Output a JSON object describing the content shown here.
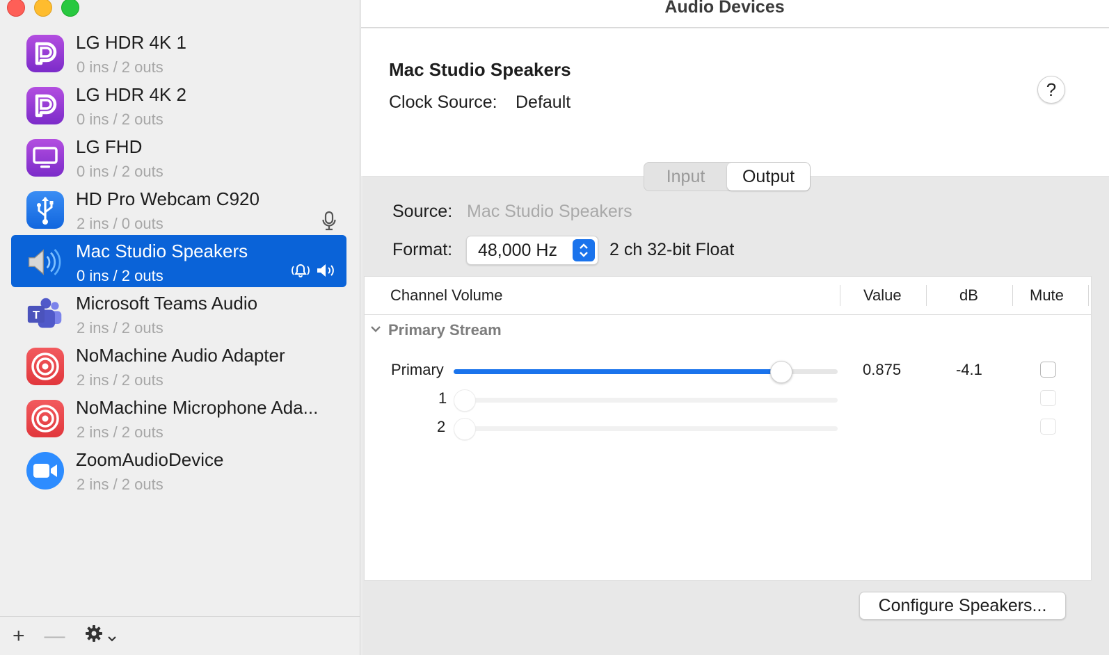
{
  "window": {
    "title": "Audio Devices"
  },
  "devices": [
    {
      "name": "LG HDR 4K 1",
      "io": "0 ins / 2 outs",
      "icon": "displayport-icon"
    },
    {
      "name": "LG HDR 4K 2",
      "io": "0 ins / 2 outs",
      "icon": "displayport-icon"
    },
    {
      "name": "LG FHD",
      "io": "0 ins / 2 outs",
      "icon": "monitor-icon"
    },
    {
      "name": "HD Pro Webcam C920",
      "io": "2 ins / 0 outs",
      "icon": "usb-icon",
      "badge": "microphone-icon"
    },
    {
      "name": "Mac Studio Speakers",
      "io": "0 ins / 2 outs",
      "icon": "speaker-icon",
      "selected": true
    },
    {
      "name": "Microsoft Teams Audio",
      "io": "2 ins / 2 outs",
      "icon": "teams-icon"
    },
    {
      "name": "NoMachine Audio Adapter",
      "io": "2 ins / 2 outs",
      "icon": "nomachine-icon"
    },
    {
      "name": "NoMachine Microphone Ada...",
      "io": "2 ins / 2 outs",
      "icon": "nomachine-icon"
    },
    {
      "name": "ZoomAudioDevice",
      "io": "2 ins / 2 outs",
      "icon": "zoom-icon"
    }
  ],
  "sidebar_toolbar": {
    "add": "+",
    "remove": "—"
  },
  "detail": {
    "device_title": "Mac Studio Speakers",
    "clock_source_label": "Clock Source:",
    "clock_source_value": "Default",
    "help": "?",
    "tabs": [
      {
        "label": "Input",
        "active": false
      },
      {
        "label": "Output",
        "active": true
      }
    ],
    "source_label": "Source:",
    "source_value": "Mac Studio Speakers",
    "format_label": "Format:",
    "format_value": "48,000 Hz",
    "format_extra": "2 ch 32-bit Float",
    "table": {
      "columns": [
        "Channel Volume",
        "Value",
        "dB",
        "Mute"
      ],
      "group": "Primary Stream",
      "rows": [
        {
          "name": "Primary",
          "level": 0.875,
          "value": "0.875",
          "db": "-4.1",
          "enabled": true
        },
        {
          "name": "1",
          "level": 0,
          "value": "",
          "db": "",
          "enabled": false
        },
        {
          "name": "2",
          "level": 0,
          "value": "",
          "db": "",
          "enabled": false
        }
      ]
    },
    "configure_button": "Configure Speakers..."
  },
  "colors": {
    "accent": "#0a63d8",
    "selection": "#0a63d8",
    "slider_fill": "#1a73ec"
  }
}
